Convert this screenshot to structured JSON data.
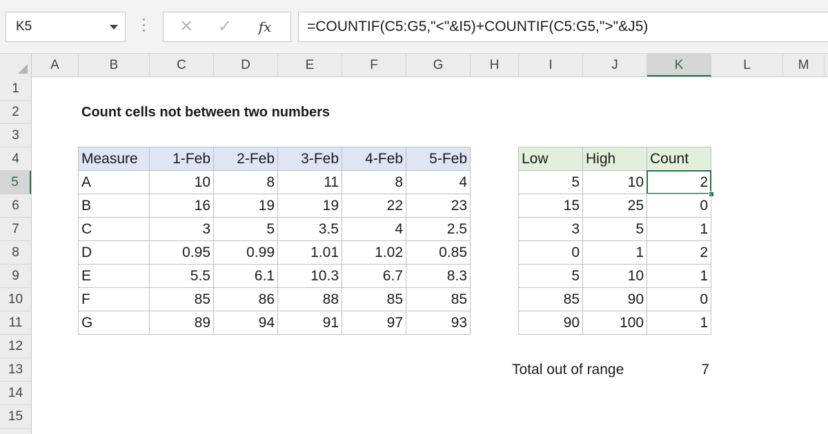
{
  "formula_bar": {
    "name_box": "K5",
    "cancel_icon": "x-icon",
    "enter_icon": "check-icon",
    "function_icon": "fx-icon",
    "function_label": "fx",
    "formula": "=COUNTIF(C5:G5,\"<\"&I5)+COUNTIF(C5:G5,\">\"&J5)"
  },
  "columns": [
    "A",
    "B",
    "C",
    "D",
    "E",
    "F",
    "G",
    "H",
    "I",
    "J",
    "K",
    "L",
    "M"
  ],
  "active_column": "K",
  "rows": [
    "1",
    "2",
    "3",
    "4",
    "5",
    "6",
    "7",
    "8",
    "9",
    "10",
    "11",
    "12",
    "13",
    "14",
    "15"
  ],
  "active_row": "5",
  "title": "Count cells not between two numbers",
  "data_table": {
    "headers": [
      "Measure",
      "1-Feb",
      "2-Feb",
      "3-Feb",
      "4-Feb",
      "5-Feb"
    ],
    "rows": [
      [
        "A",
        "10",
        "8",
        "11",
        "8",
        "4"
      ],
      [
        "B",
        "16",
        "19",
        "19",
        "22",
        "23"
      ],
      [
        "C",
        "3",
        "5",
        "3.5",
        "4",
        "2.5"
      ],
      [
        "D",
        "0.95",
        "0.99",
        "1.01",
        "1.02",
        "0.85"
      ],
      [
        "E",
        "5.5",
        "6.1",
        "10.3",
        "6.7",
        "8.3"
      ],
      [
        "F",
        "85",
        "86",
        "88",
        "85",
        "85"
      ],
      [
        "G",
        "89",
        "94",
        "91",
        "97",
        "93"
      ]
    ]
  },
  "range_table": {
    "headers": [
      "Low",
      "High",
      "Count"
    ],
    "rows": [
      [
        "5",
        "10",
        "2"
      ],
      [
        "15",
        "25",
        "0"
      ],
      [
        "3",
        "5",
        "1"
      ],
      [
        "0",
        "1",
        "2"
      ],
      [
        "5",
        "10",
        "1"
      ],
      [
        "85",
        "90",
        "0"
      ],
      [
        "90",
        "100",
        "1"
      ]
    ]
  },
  "total": {
    "label": "Total out of range",
    "value": "7"
  },
  "colors": {
    "accent": "#217346",
    "header_blue": "#dfe5f5",
    "header_green": "#e2efda"
  }
}
